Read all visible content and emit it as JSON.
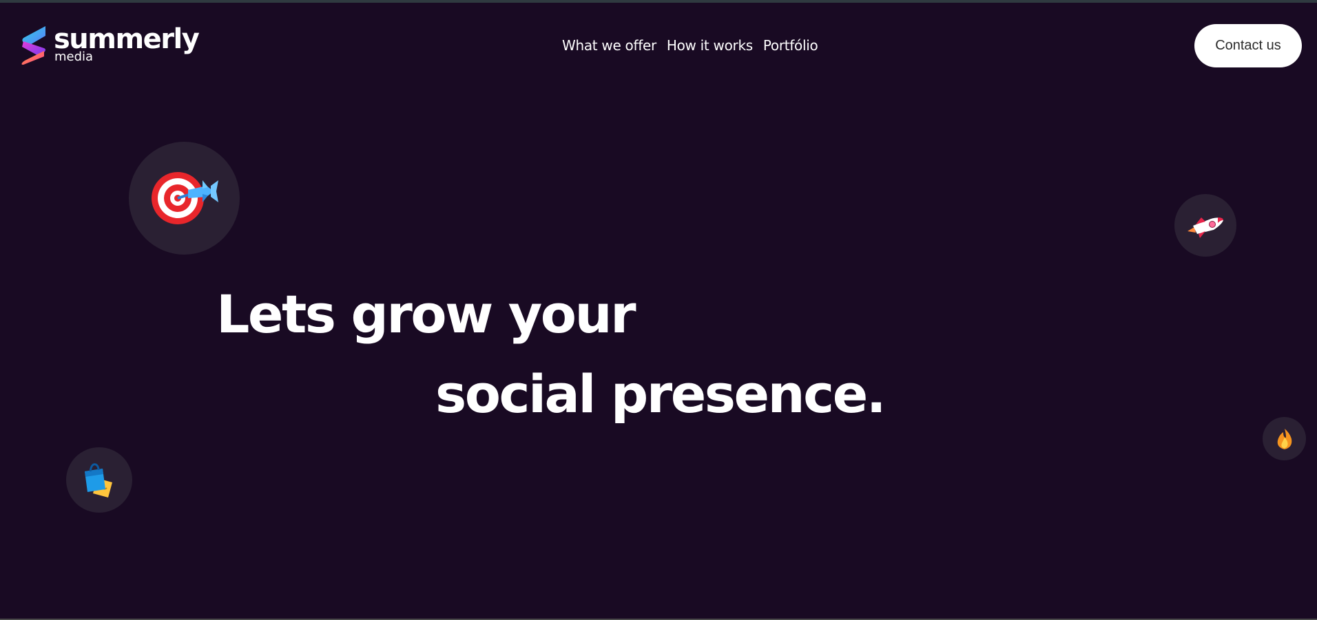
{
  "brand": {
    "name": "summerly",
    "subtitle": "media"
  },
  "nav": {
    "items": [
      {
        "label": "What we offer"
      },
      {
        "label": "How it works"
      },
      {
        "label": "Portfólio"
      }
    ]
  },
  "header": {
    "contact_label": "Contact us"
  },
  "hero": {
    "line1": "Lets grow your",
    "line2": "social presence."
  },
  "icons": [
    "target-dart-icon",
    "rocket-icon",
    "shopping-bags-icon",
    "fire-icon"
  ],
  "colors": {
    "background": "#190a23",
    "bubble": "#2a2033",
    "button_bg": "#ffffff",
    "button_text": "#2b2b2b"
  }
}
